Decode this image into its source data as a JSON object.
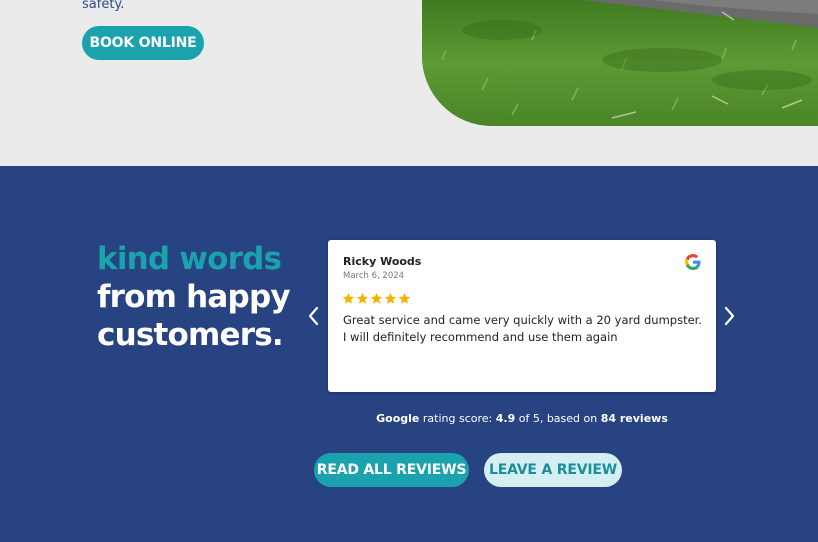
{
  "hero": {
    "text_fragment": "safety.",
    "book_button": "BOOK ONLINE"
  },
  "testimonials": {
    "heading_line1": "kind words",
    "heading_line2": "from happy",
    "heading_line3": "customers.",
    "review": {
      "author": "Ricky Woods",
      "date": "March 6, 2024",
      "stars": 5,
      "text": "Great service and came very quickly with a 20 yard dumpster. I will definitely recommend and use them again",
      "source_icon": "google-icon"
    },
    "rating": {
      "brand": "Google",
      "label": "rating score:",
      "score": "4.9",
      "of_text": "of 5, based on",
      "count": "84 reviews"
    },
    "read_all_button": "READ ALL REVIEWS",
    "leave_review_button": "LEAVE A REVIEW"
  },
  "colors": {
    "navy": "#274381",
    "teal": "#1aa3ad",
    "light_teal": "#d4eef1",
    "star": "#f5b301"
  }
}
